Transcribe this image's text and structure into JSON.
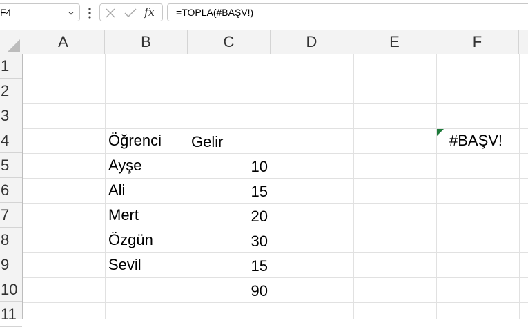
{
  "name_box": {
    "value": "F4"
  },
  "formula_bar": {
    "formula": "=TOPLA(#BAŞV!)",
    "fx_label": "fx"
  },
  "columns": [
    "A",
    "B",
    "C",
    "D",
    "E",
    "F"
  ],
  "rows": [
    "1",
    "2",
    "3",
    "4",
    "5",
    "6",
    "7",
    "8",
    "9",
    "10",
    "11"
  ],
  "cells": {
    "B4": "Öğrenci",
    "C4": "Gelir",
    "B5": "Ayşe",
    "C5": "10",
    "B6": "Ali",
    "C6": "15",
    "B7": "Mert",
    "C7": "20",
    "B8": "Özgün",
    "C8": "30",
    "B9": "Sevil",
    "C9": "15",
    "C10": "90",
    "F4": "#BAŞV!"
  },
  "colors": {
    "error_indicator": "#1e7a3a",
    "header_bg": "#f3f3f3",
    "gridline": "#e1e1e1"
  }
}
